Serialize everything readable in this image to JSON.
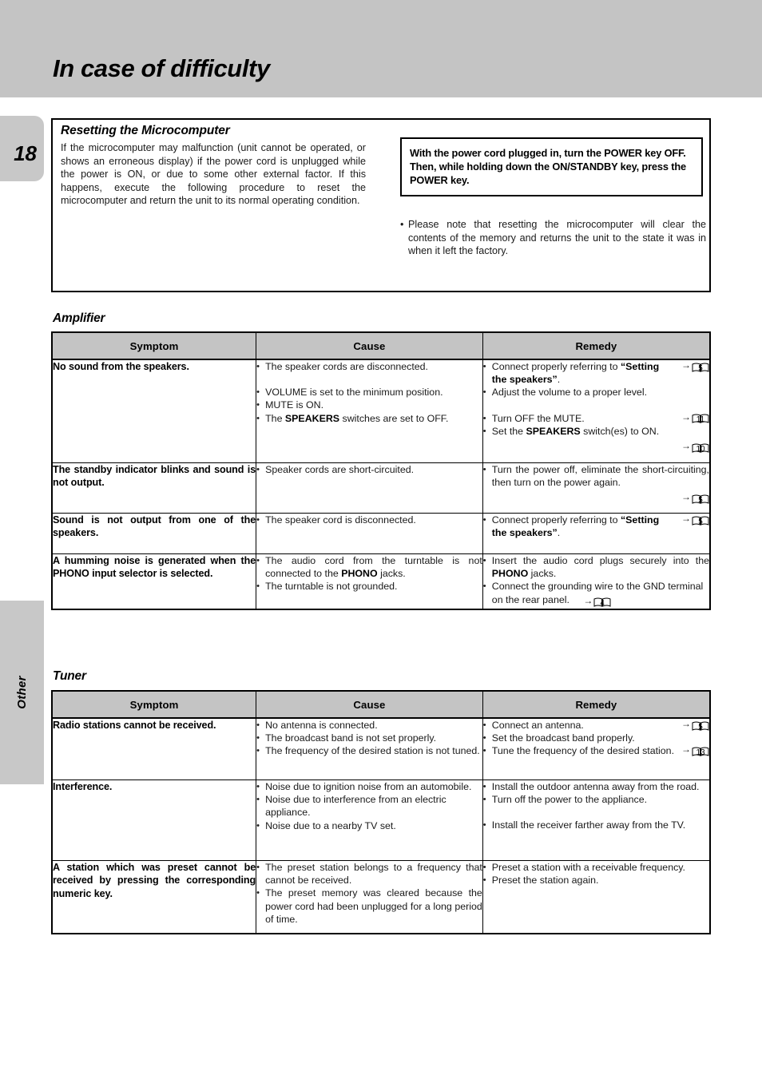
{
  "header": {
    "title": "In case of difficulty",
    "band_color": "#c4c4c4"
  },
  "margin": {
    "page_number": "18",
    "section_tab_label": "Other"
  },
  "reset_box": {
    "heading": "Resetting the Microcomputer",
    "body": "If the microcomputer may malfunction (unit cannot be operated, or shows an erroneous display) if the power cord is unplugged while the power is ON, or due to some other external factor. If this happens, execute the following procedure to reset the microcomputer and return the unit to its normal operating condition.",
    "power_note": "With the power cord plugged in, turn the POWER key OFF. Then, while holding down the ON/STANDBY key, press the POWER key.",
    "bullet_note": "Please note that resetting the microcomputer will clear the contents of the memory and returns the unit to the state it was in when it left the factory."
  },
  "tables": {
    "columns": [
      "Symptom",
      "Cause",
      "Remedy"
    ],
    "amplifier": {
      "title": "Amplifier",
      "rows": [
        {
          "symptom": "No sound from the speakers.",
          "cause": [
            "The speaker cords are disconnected.",
            "VOLUME is set to the minimum position.",
            "MUTE is ON.",
            "The SPEAKERS switches are set to OFF."
          ],
          "remedy": [
            "Connect properly referring to “Setting the speakers”.",
            "Adjust the volume to a proper level.",
            "Turn OFF the MUTE.",
            "Set the SPEAKERS switch(es) to ON."
          ],
          "page_refs": [
            "5",
            "11",
            "10"
          ]
        },
        {
          "symptom": "The standby indicator blinks and sound is not output.",
          "cause": [
            "Speaker cords are short-circuited."
          ],
          "remedy": [
            "Turn the power off, eliminate the short-circuiting, then turn on the power again."
          ],
          "page_refs": [
            "5"
          ]
        },
        {
          "symptom": "Sound is not output from one of the speakers.",
          "cause": [
            "The speaker cord is disconnected."
          ],
          "remedy": [
            "Connect properly referring to “Setting the speakers”."
          ],
          "page_refs": [
            "5"
          ]
        },
        {
          "symptom": "A humming noise is generated when the PHONO input selector is selected.",
          "cause": [
            "The audio cord from the turntable is not connected to the PHONO jacks.",
            "The turntable is not grounded."
          ],
          "remedy": [
            "Insert the audio cord plugs securely into the PHONO jacks.",
            "Connect the grounding wire to the GND terminal on the rear panel."
          ],
          "page_refs": [
            "4"
          ]
        }
      ]
    },
    "tuner": {
      "title": "Tuner",
      "rows": [
        {
          "symptom": "Radio stations cannot be received.",
          "cause": [
            "No antenna is connected.",
            "The broadcast band is not set properly.",
            "The frequency of the desired station is not tuned."
          ],
          "remedy": [
            "Connect an antenna.",
            "Set the broadcast band properly.",
            "Tune the frequency of the desired station."
          ],
          "page_refs": [
            "5",
            "13"
          ]
        },
        {
          "symptom": "Interference.",
          "cause": [
            "Noise due to ignition noise from an automobile.",
            "Noise due to interference from an electric appliance.",
            "Noise due to a nearby TV set."
          ],
          "remedy": [
            "Install the outdoor antenna away from the road.",
            "Turn off the power to the appliance.",
            "Install the receiver farther away from the TV."
          ],
          "page_refs": []
        },
        {
          "symptom": "A station which was preset cannot be received by pressing the corresponding numeric key.",
          "cause": [
            "The preset station belongs to a frequency that cannot be received.",
            "The preset memory was cleared because the power cord had been unplugged for a long period of time."
          ],
          "remedy": [
            "Preset a station with a receivable frequency.",
            "Preset the station again."
          ],
          "page_refs": []
        }
      ]
    }
  },
  "icons": {
    "page_ref": "open-book-icon",
    "arrow": "→"
  }
}
